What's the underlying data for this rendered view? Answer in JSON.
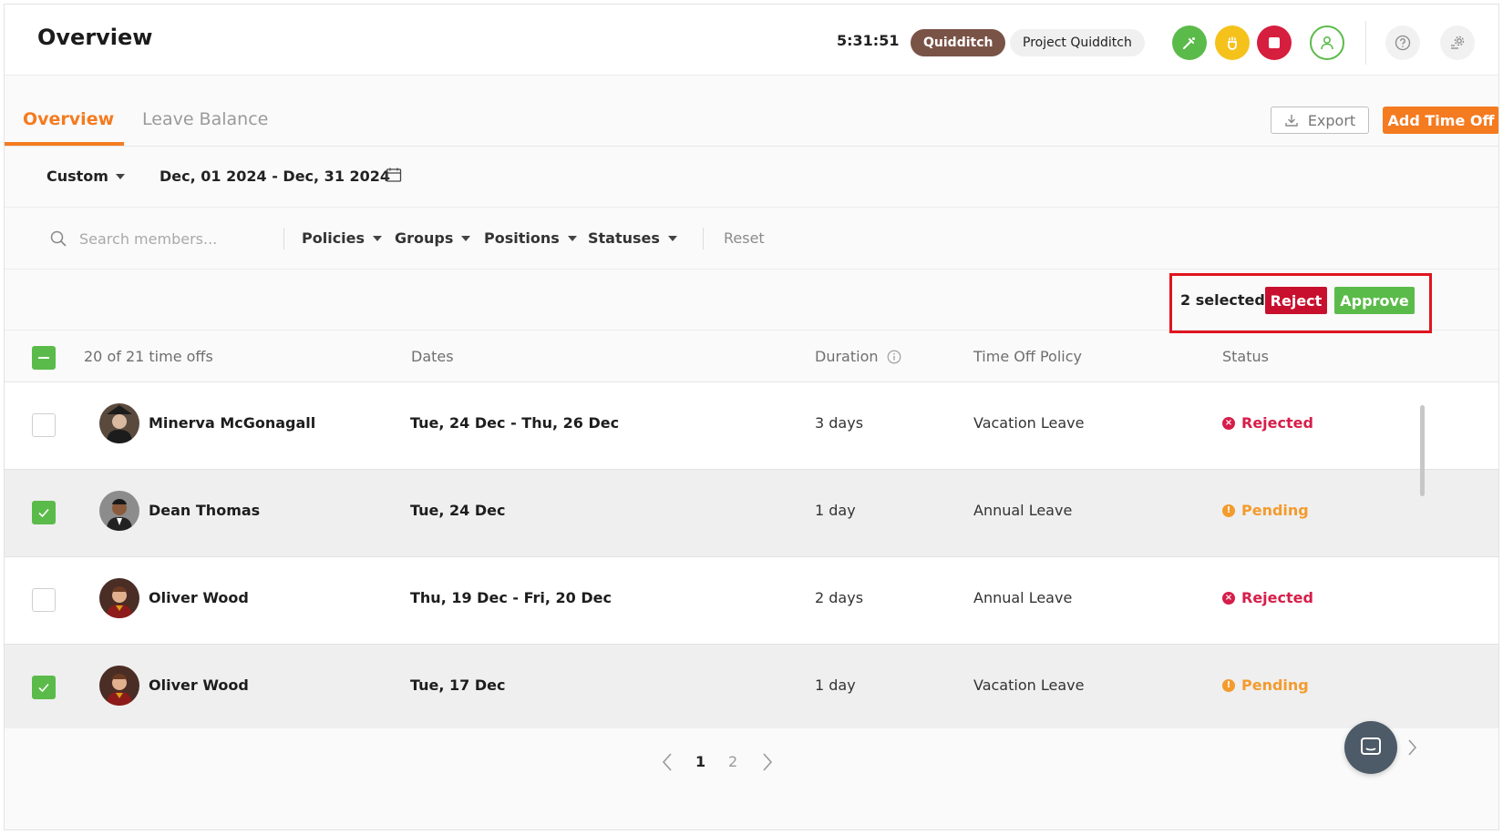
{
  "header": {
    "title": "Overview",
    "timer": "5:31:51",
    "project": "Quidditch",
    "task": "Project Quidditch",
    "icons": [
      "edit-timer-icon",
      "break-icon",
      "stop-icon",
      "user-icon",
      "help-icon",
      "settings-icon"
    ]
  },
  "tabs": [
    {
      "label": "Overview",
      "active": true
    },
    {
      "label": "Leave Balance",
      "active": false
    }
  ],
  "actions": {
    "export_label": "Export",
    "add_label": "Add Time Off"
  },
  "date_filter": {
    "range_type": "Custom",
    "range": "Dec, 01 2024 - Dec, 31 2024"
  },
  "filters": {
    "search_placeholder": "Search members...",
    "policies": "Policies",
    "groups": "Groups",
    "positions": "Positions",
    "statuses": "Statuses",
    "reset": "Reset"
  },
  "bulk": {
    "selected_text": "2 selected",
    "reject_label": "Reject",
    "approve_label": "Approve"
  },
  "table": {
    "count_label": "20 of 21 time offs",
    "columns": {
      "dates": "Dates",
      "duration": "Duration",
      "policy": "Time Off Policy",
      "status": "Status"
    },
    "rows": [
      {
        "name": "Minerva McGonagall",
        "dates": "Tue, 24 Dec - Thu, 26 Dec",
        "duration": "3 days",
        "policy": "Vacation Leave",
        "status": "Rejected",
        "selected": false
      },
      {
        "name": "Dean Thomas",
        "dates": "Tue, 24 Dec",
        "duration": "1 day",
        "policy": "Annual Leave",
        "status": "Pending",
        "selected": true
      },
      {
        "name": "Oliver Wood",
        "dates": "Thu, 19 Dec - Fri, 20 Dec",
        "duration": "2 days",
        "policy": "Annual Leave",
        "status": "Rejected",
        "selected": false
      },
      {
        "name": "Oliver Wood",
        "dates": "Tue, 17 Dec",
        "duration": "1 day",
        "policy": "Vacation Leave",
        "status": "Pending",
        "selected": true
      }
    ]
  },
  "pagination": {
    "pages": [
      "1",
      "2"
    ],
    "current": "1"
  },
  "colors": {
    "accent": "#f47b20",
    "approve": "#5bbb4a",
    "reject": "#c8102e",
    "rejected_status": "#d61e4a",
    "pending_status": "#f39b2d",
    "project_pill": "#7a5347"
  }
}
